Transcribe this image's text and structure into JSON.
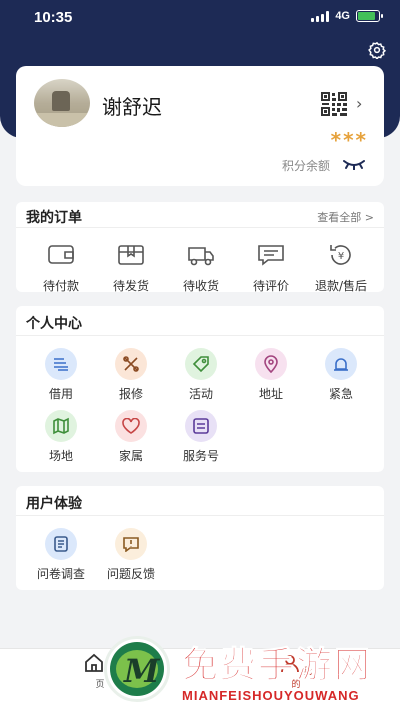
{
  "status_bar": {
    "time": "10:35",
    "network": "4G"
  },
  "profile": {
    "username": "谢舒迟",
    "points_value": "***",
    "points_label": "积分余额"
  },
  "orders": {
    "title": "我的订单",
    "view_all": "查看全部 >",
    "items": [
      {
        "label": "待付款",
        "icon": "wallet-icon"
      },
      {
        "label": "待发货",
        "icon": "box-icon"
      },
      {
        "label": "待收货",
        "icon": "truck-icon"
      },
      {
        "label": "待评价",
        "icon": "comment-icon"
      },
      {
        "label": "退款/售后",
        "icon": "refund-icon"
      }
    ]
  },
  "personal": {
    "title": "个人中心",
    "items": [
      {
        "label": "借用",
        "icon": "borrow-icon",
        "color": "#dbe8fb"
      },
      {
        "label": "报修",
        "icon": "tools-icon",
        "color": "#fbe6d7"
      },
      {
        "label": "活动",
        "icon": "tag-icon",
        "color": "#e0f3df"
      },
      {
        "label": "地址",
        "icon": "location-icon",
        "color": "#f7e1ef"
      },
      {
        "label": "紧急",
        "icon": "alarm-icon",
        "color": "#dbe8fb"
      },
      {
        "label": "场地",
        "icon": "map-icon",
        "color": "#e0f3df"
      },
      {
        "label": "家属",
        "icon": "heart-icon",
        "color": "#fbe1e1"
      },
      {
        "label": "服务号",
        "icon": "service-icon",
        "color": "#e8e1f6"
      }
    ]
  },
  "experience": {
    "title": "用户体验",
    "items": [
      {
        "label": "问卷调查",
        "icon": "survey-icon",
        "color": "#dbe8fb"
      },
      {
        "label": "问题反馈",
        "icon": "feedback-icon",
        "color": "#fbeedc"
      }
    ]
  },
  "tabbar": {
    "home_label": "首页",
    "mine_label": "我的"
  },
  "watermark": {
    "title": "免费手游网",
    "subtitle": "MIANFEISHOUYOUWANG",
    "logo_letter": "M"
  },
  "colors": {
    "header_bg": "#1d2a55",
    "accent": "#e6a23c",
    "watermark_red": "#d62828"
  }
}
